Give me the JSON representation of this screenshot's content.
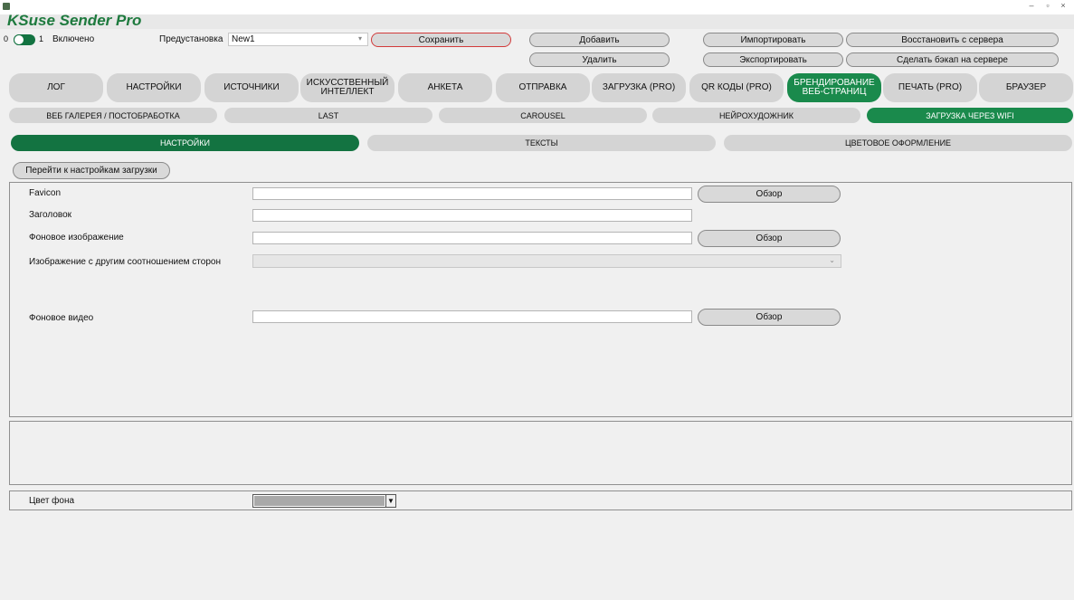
{
  "app": {
    "title": "KSuse Sender Pro"
  },
  "window": {
    "minimize": "–",
    "restore": "▫",
    "close": "×"
  },
  "topbar": {
    "toggle_off_label": "0",
    "toggle_on_label": "1",
    "enabled_label": "Включено",
    "preset_label": "Предустановка",
    "preset_value": "New1",
    "save": "Сохранить",
    "add": "Добавить",
    "delete": "Удалить",
    "import": "Импортировать",
    "export": "Экспортировать",
    "restore": "Восстановить с сервера",
    "backup": "Сделать бэкап на сервере"
  },
  "main_tabs": [
    {
      "label": "ЛОГ",
      "active": false
    },
    {
      "label": "НАСТРОЙКИ",
      "active": false
    },
    {
      "label": "ИСТОЧНИКИ",
      "active": false
    },
    {
      "label": "ИСКУССТВЕННЫЙ ИНТЕЛЛЕКТ",
      "active": false
    },
    {
      "label": "АНКЕТА",
      "active": false
    },
    {
      "label": "ОТПРАВКА",
      "active": false
    },
    {
      "label": "ЗАГРУЗКА (PRO)",
      "active": false
    },
    {
      "label": "QR КОДЫ (PRO)",
      "active": false
    },
    {
      "label": "БРЕНДИРОВАНИЕ ВЕБ-СТРАНИЦ",
      "active": true
    },
    {
      "label": "ПЕЧАТЬ (PRO)",
      "active": false
    },
    {
      "label": "БРАУЗЕР",
      "active": false
    }
  ],
  "sub_tabs": [
    {
      "label": "ВЕБ ГАЛЕРЕЯ / ПОСТОБРАБОТКА",
      "active": false
    },
    {
      "label": "LAST",
      "active": false
    },
    {
      "label": "CAROUSEL",
      "active": false
    },
    {
      "label": "НЕЙРОХУДОЖНИК",
      "active": false
    },
    {
      "label": "ЗАГРУЗКА ЧЕРЕЗ WIFI",
      "active": true
    }
  ],
  "section_tabs": [
    {
      "label": "НАСТРОЙКИ",
      "active": true
    },
    {
      "label": "ТЕКСТЫ",
      "active": false
    },
    {
      "label": "ЦВЕТОВОЕ ОФОРМЛЕНИЕ",
      "active": false
    }
  ],
  "goto_upload_settings": "Перейти к настройкам загрузки",
  "form": {
    "favicon_label": "Favicon",
    "favicon_value": "",
    "title_label": "Заголовок",
    "title_value": "",
    "bg_image_label": "Фоновое изображение",
    "bg_image_value": "",
    "alt_ratio_label": "Изображение с другим соотношением сторон",
    "alt_ratio_value": "",
    "bg_video_label": "Фоновое видео",
    "bg_video_value": "",
    "browse": "Обзор"
  },
  "background_color": {
    "label": "Цвет фона",
    "value": "",
    "swatch": "#a9a9a9"
  },
  "colors": {
    "accent": "#137341",
    "brand_text": "#1e7a3e",
    "save_outline": "#d23b3b"
  }
}
